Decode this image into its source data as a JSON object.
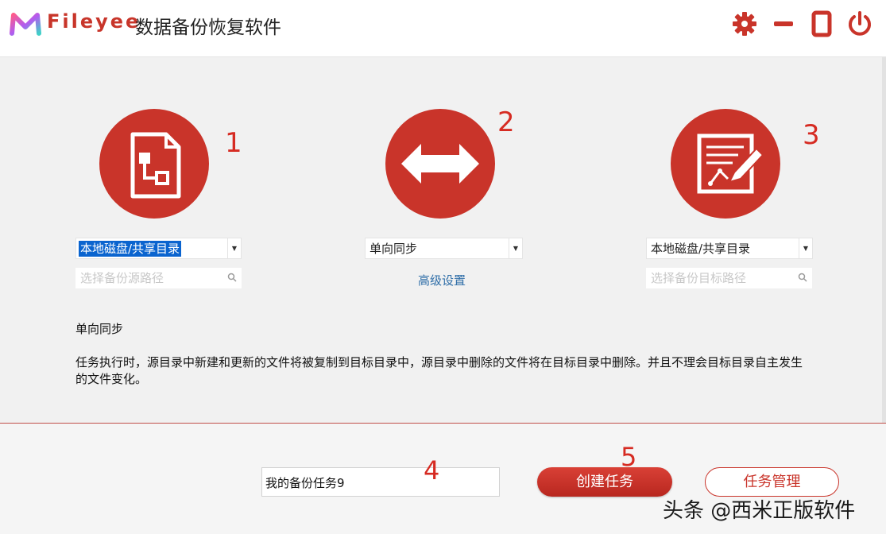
{
  "header": {
    "brand": "Fileyee",
    "title": "数据备份恢复软件",
    "brand_color": "#c8352a",
    "icons": [
      "settings-gear-icon",
      "minimize-icon",
      "maximize-icon",
      "power-icon"
    ]
  },
  "steps": [
    {
      "number": "1",
      "icon": "file-structure-icon"
    },
    {
      "number": "2",
      "icon": "double-arrow-icon"
    },
    {
      "number": "3",
      "icon": "edit-document-icon"
    }
  ],
  "source": {
    "type_selected": "本地磁盘/共享目录",
    "path_placeholder": "选择备份源路径"
  },
  "sync": {
    "mode_selected": "单向同步",
    "advanced_label": "高级设置"
  },
  "target": {
    "type_selected": "本地磁盘/共享目录",
    "path_placeholder": "选择备份目标路径"
  },
  "description": {
    "mode_title": "单向同步",
    "text": "任务执行时，源目录中新建和更新的文件将被复制到目标目录中，源目录中删除的文件将在目标目录中删除。并且不理会目标目录自主发生的文件变化。"
  },
  "bottom": {
    "task_name": "我的备份任务9",
    "step4": "4",
    "step5": "5",
    "create_label": "创建任务",
    "manage_label": "任务管理"
  },
  "watermark": "头条 @西米正版软件",
  "accent_color": "#c9342a"
}
